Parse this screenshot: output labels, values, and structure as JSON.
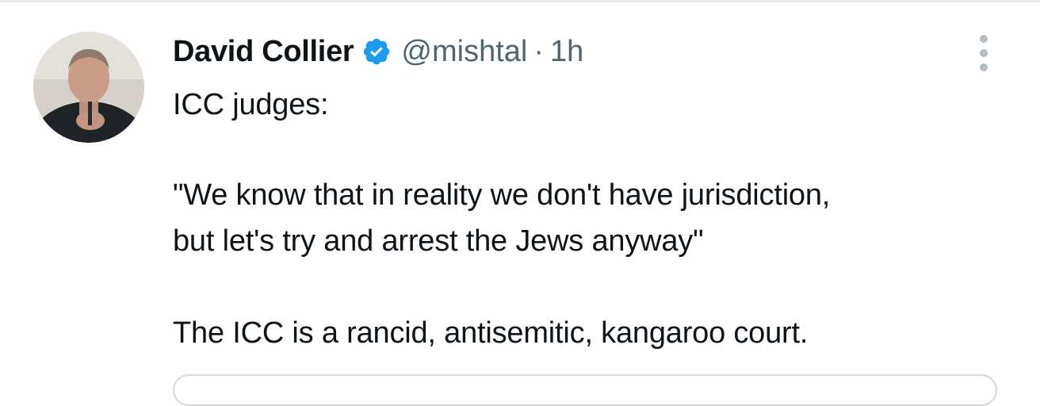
{
  "tweet": {
    "author": {
      "display_name": "David Collier",
      "verified": true,
      "handle": "@mishtal",
      "separator": "·",
      "time": "1h"
    },
    "body": {
      "line1": "ICC judges:",
      "line2": "\"We know that in reality we don't have jurisdiction,",
      "line3": "but let's try and arrest the Jews anyway\"",
      "line4": "The ICC is a rancid, antisemitic,  kangaroo court."
    },
    "icons": {
      "verified": "verified-badge-icon",
      "more": "more-options-icon"
    },
    "colors": {
      "text": "#0f1419",
      "secondary": "#536471",
      "verified": "#1d9bf0",
      "divider": "#e6ecf0"
    }
  }
}
